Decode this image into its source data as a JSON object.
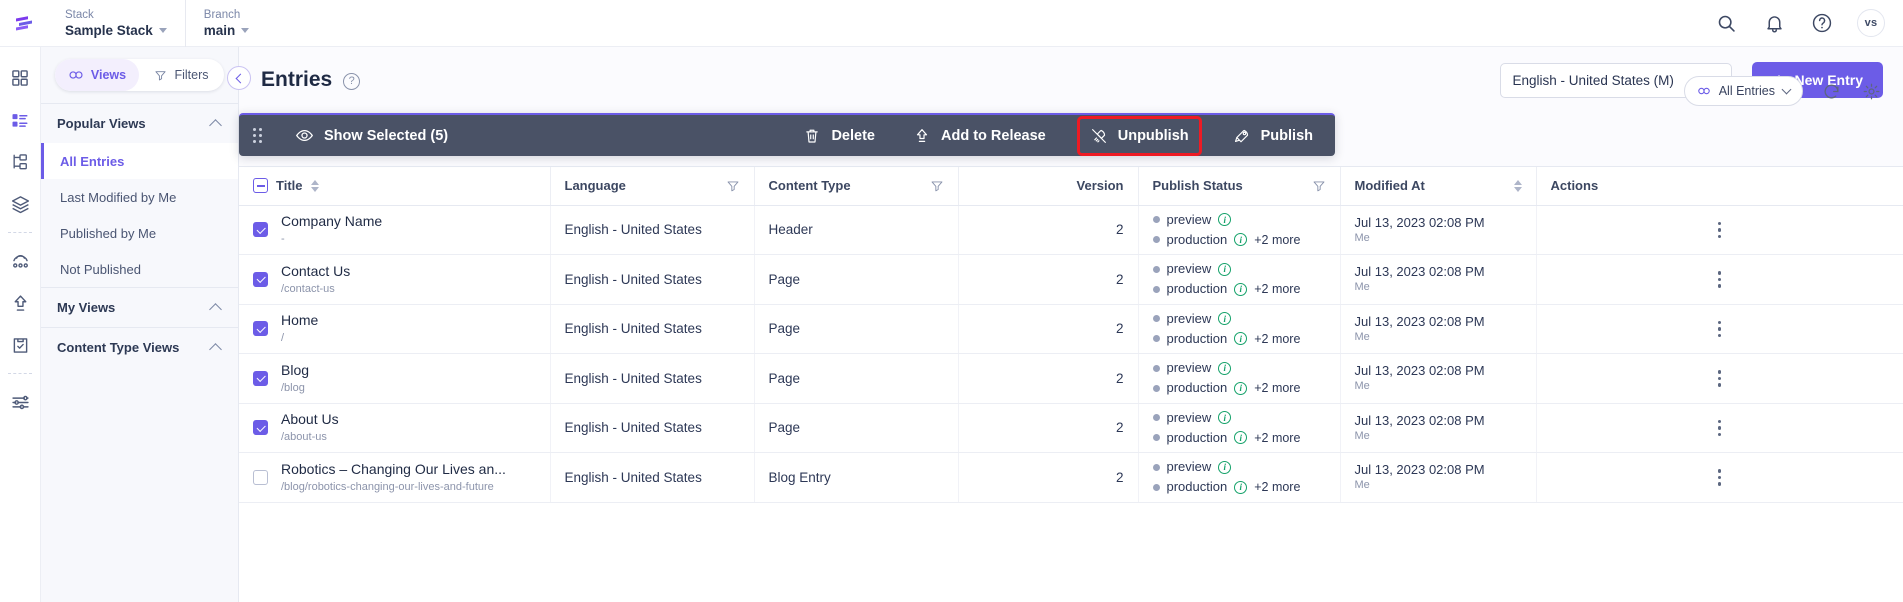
{
  "topbar": {
    "logo_icon": "contentstack-logo-icon",
    "stack": {
      "label": "Stack",
      "value": "Sample Stack"
    },
    "branch": {
      "label": "Branch",
      "value": "main"
    },
    "icons": [
      "search-icon",
      "notification-bell-icon",
      "help-circle-icon"
    ],
    "avatar_initials": "vs"
  },
  "rail": {
    "items": [
      {
        "name": "dashboard-icon"
      },
      {
        "name": "entries-icon"
      },
      {
        "name": "content-models-icon"
      },
      {
        "name": "assets-stack-icon"
      },
      {
        "name": "extensions-icon"
      },
      {
        "name": "publish-queue-icon"
      },
      {
        "name": "release-tasks-icon"
      },
      {
        "name": "settings-sliders-icon"
      }
    ]
  },
  "sidebar": {
    "views_button": "Views",
    "filters_button": "Filters",
    "groups": [
      {
        "title": "Popular Views",
        "items": [
          {
            "label": "All Entries",
            "active": true
          },
          {
            "label": "Last Modified by Me",
            "active": false
          },
          {
            "label": "Published by Me",
            "active": false
          },
          {
            "label": "Not Published",
            "active": false
          }
        ]
      },
      {
        "title": "My Views",
        "items": []
      },
      {
        "title": "Content Type Views",
        "items": []
      }
    ]
  },
  "header": {
    "title": "Entries",
    "help_icon": "help-circle-icon",
    "collapse_icon": "chevron-left-icon",
    "locale": "English - United States (M)",
    "new_entry": "New Entry"
  },
  "utilities": {
    "view_pill": "All Entries",
    "refresh_icon": "refresh-icon",
    "settings_icon": "gear-icon"
  },
  "action_bar": {
    "drag_handle": "drag-handle-icon",
    "show_selected": "Show Selected (5)",
    "actions": [
      {
        "label": "Delete",
        "icon": "trash-icon",
        "highlighted": false
      },
      {
        "label": "Add to Release",
        "icon": "upload-arrow-icon",
        "highlighted": false
      },
      {
        "label": "Unpublish",
        "icon": "unpublish-icon",
        "highlighted": true
      },
      {
        "label": "Publish",
        "icon": "rocket-icon",
        "highlighted": false
      }
    ],
    "highlight_color": "#ee1b24",
    "background_color": "#4a5266",
    "accent_color": "#6c5ce7"
  },
  "table": {
    "columns": [
      {
        "label": "Title",
        "sortable": true,
        "filter": false,
        "align": "left"
      },
      {
        "label": "Language",
        "sortable": false,
        "filter": true,
        "align": "left"
      },
      {
        "label": "Content Type",
        "sortable": false,
        "filter": true,
        "align": "left"
      },
      {
        "label": "Version",
        "sortable": false,
        "filter": false,
        "align": "right"
      },
      {
        "label": "Publish Status",
        "sortable": false,
        "filter": true,
        "align": "left"
      },
      {
        "label": "Modified At",
        "sortable": true,
        "filter": false,
        "align": "left"
      },
      {
        "label": "Actions",
        "sortable": false,
        "filter": false,
        "align": "center"
      }
    ],
    "rows": [
      {
        "selected": true,
        "title": "Company Name",
        "url": "-",
        "language": "English - United States",
        "content_type": "Header",
        "version": "2",
        "status": [
          {
            "env": "preview",
            "more": ""
          },
          {
            "env": "production",
            "more": "+2 more"
          }
        ],
        "modified_at": "Jul 13, 2023 02:08 PM",
        "modified_by": "Me"
      },
      {
        "selected": true,
        "title": "Contact Us",
        "url": "/contact-us",
        "language": "English - United States",
        "content_type": "Page",
        "version": "2",
        "status": [
          {
            "env": "preview",
            "more": ""
          },
          {
            "env": "production",
            "more": "+2 more"
          }
        ],
        "modified_at": "Jul 13, 2023 02:08 PM",
        "modified_by": "Me"
      },
      {
        "selected": true,
        "title": "Home",
        "url": "/",
        "language": "English - United States",
        "content_type": "Page",
        "version": "2",
        "status": [
          {
            "env": "preview",
            "more": ""
          },
          {
            "env": "production",
            "more": "+2 more"
          }
        ],
        "modified_at": "Jul 13, 2023 02:08 PM",
        "modified_by": "Me"
      },
      {
        "selected": true,
        "title": "Blog",
        "url": "/blog",
        "language": "English - United States",
        "content_type": "Page",
        "version": "2",
        "status": [
          {
            "env": "preview",
            "more": ""
          },
          {
            "env": "production",
            "more": "+2 more"
          }
        ],
        "modified_at": "Jul 13, 2023 02:08 PM",
        "modified_by": "Me"
      },
      {
        "selected": true,
        "title": "About Us",
        "url": "/about-us",
        "language": "English - United States",
        "content_type": "Page",
        "version": "2",
        "status": [
          {
            "env": "preview",
            "more": ""
          },
          {
            "env": "production",
            "more": "+2 more"
          }
        ],
        "modified_at": "Jul 13, 2023 02:08 PM",
        "modified_by": "Me"
      },
      {
        "selected": false,
        "title": "Robotics – Changing Our Lives an...",
        "url": "/blog/robotics-changing-our-lives-and-future",
        "language": "English - United States",
        "content_type": "Blog Entry",
        "version": "2",
        "status": [
          {
            "env": "preview",
            "more": ""
          },
          {
            "env": "production",
            "more": "+2 more"
          }
        ],
        "modified_at": "Jul 13, 2023 02:08 PM",
        "modified_by": "Me"
      }
    ]
  }
}
